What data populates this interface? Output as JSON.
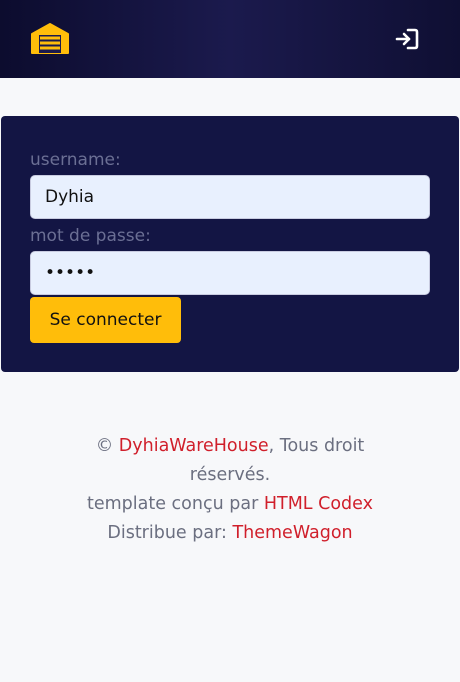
{
  "navbar": {
    "brand_icon": "warehouse-icon",
    "login_icon": "sign-in-icon",
    "brand_color": "#ffbd0a"
  },
  "form": {
    "username_label": "username:",
    "username_value": "Dyhia",
    "password_label": "mot de passe:",
    "password_masked": "•••••",
    "submit_label": "Se connecter"
  },
  "footer": {
    "copyright_symbol": "©",
    "site_name": "DyhiaWareHouse",
    "rights_text_1": ", Tous droit",
    "rights_text_2": "réservés.",
    "template_text": "template conçu par ",
    "template_link": "HTML Codex",
    "distrib_text": "Distribue par: ",
    "distrib_link": "ThemeWagon",
    "link_color": "#d01f2b"
  }
}
